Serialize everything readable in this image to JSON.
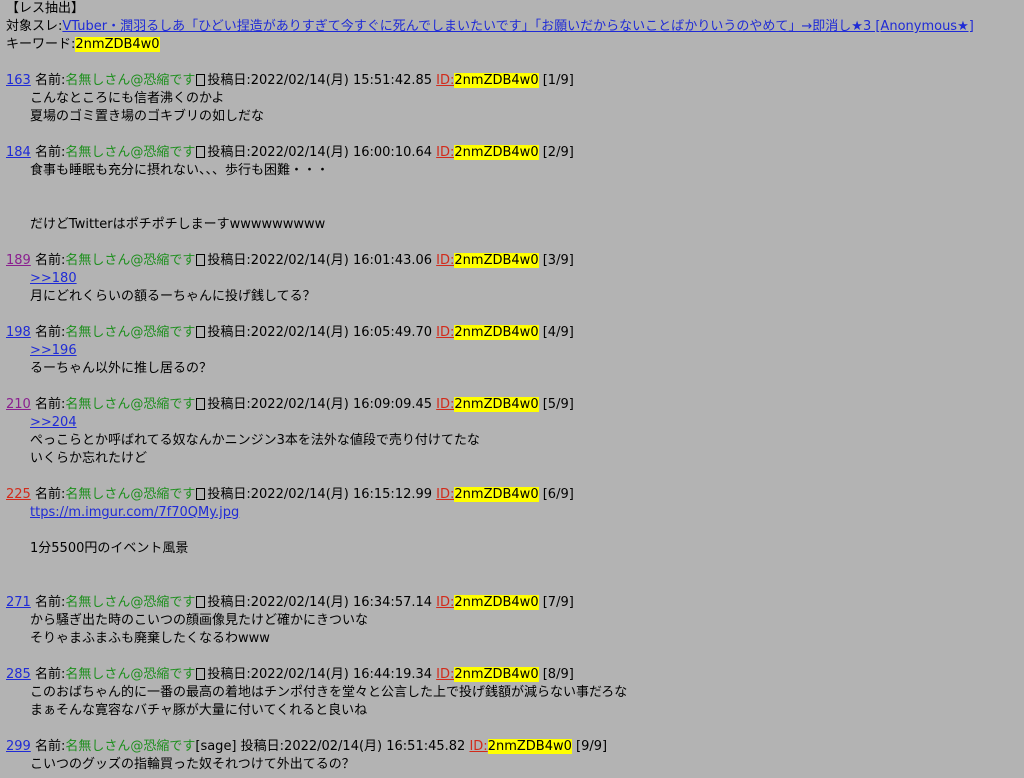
{
  "header": {
    "title": "【レス抽出】",
    "target_label": "対象スレ:",
    "target_thread": "VTuber・潤羽るしあ「ひどい捏造がありすぎて今すぐに死んでしまいたいです」「お願いだからないことばかりいうのやめて」→即消し★3 [Anonymous★]",
    "keyword_label": "キーワード:",
    "keyword": "2nmZDB4w0"
  },
  "posts": [
    {
      "number": "163",
      "name_label": "名前:",
      "name": "名無しさん@恐縮です",
      "box": "□",
      "date_label": "投稿日:",
      "date": "2022/02/14(月) 15:51:42.85",
      "id_label": "ID:",
      "id": "2nmZDB4w0",
      "count": "[1/9]",
      "lines": [
        "こんなところにも信者沸くのかよ",
        "夏場のゴミ置き場のゴキブリの如しだな"
      ]
    },
    {
      "number": "184",
      "name_label": "名前:",
      "name": "名無しさん@恐縮です",
      "box": "□",
      "date_label": "投稿日:",
      "date": "2022/02/14(月) 16:00:10.64",
      "id_label": "ID:",
      "id": "2nmZDB4w0",
      "count": "[2/9]",
      "lines": [
        "食事も睡眠も充分に摂れない、、、歩行も困難・・・",
        "",
        "",
        "だけどTwitterはポチポチしまーすwwwwwwwww"
      ]
    },
    {
      "number": "189",
      "name_label": "名前:",
      "name": "名無しさん@恐縮です",
      "box": "□",
      "date_label": "投稿日:",
      "date": "2022/02/14(月) 16:01:43.06",
      "id_label": "ID:",
      "id": "2nmZDB4w0",
      "count": "[3/9]",
      "anchor": ">>180",
      "lines": [
        "月にどれくらいの額るーちゃんに投げ銭してる？"
      ]
    },
    {
      "number": "198",
      "name_label": "名前:",
      "name": "名無しさん@恐縮です",
      "box": "□",
      "date_label": "投稿日:",
      "date": "2022/02/14(月) 16:05:49.70",
      "id_label": "ID:",
      "id": "2nmZDB4w0",
      "count": "[4/9]",
      "anchor": ">>196",
      "lines": [
        "るーちゃん以外に推し居るの？"
      ]
    },
    {
      "number": "210",
      "name_label": "名前:",
      "name": "名無しさん@恐縮です",
      "box": "□",
      "date_label": "投稿日:",
      "date": "2022/02/14(月) 16:09:09.45",
      "id_label": "ID:",
      "id": "2nmZDB4w0",
      "count": "[5/9]",
      "anchor": ">>204",
      "lines": [
        "ぺっこらとか呼ばれてる奴なんかニンジン3本を法外な値段で売り付けてたな",
        "いくらか忘れたけど"
      ]
    },
    {
      "number": "225",
      "name_label": "名前:",
      "name": "名無しさん@恐縮です",
      "box": "□",
      "date_label": "投稿日:",
      "date": "2022/02/14(月) 16:15:12.99",
      "id_label": "ID:",
      "id": "2nmZDB4w0",
      "count": "[6/9]",
      "url": "ttps://m.imgur.com/7f70QMy.jpg",
      "lines": [
        "",
        "1分5500円のイベント風景"
      ]
    },
    {
      "number": "271",
      "name_label": "名前:",
      "name": "名無しさん@恐縮です",
      "box": "□",
      "date_label": "投稿日:",
      "date": "2022/02/14(月) 16:34:57.14",
      "id_label": "ID:",
      "id": "2nmZDB4w0",
      "count": "[7/9]",
      "lines": [
        "から騒ぎ出た時のこいつの顔画像見たけど確かにきついな",
        "そりゃまふまふも廃棄したくなるわwww"
      ]
    },
    {
      "number": "285",
      "name_label": "名前:",
      "name": "名無しさん@恐縮です",
      "box": "□",
      "date_label": "投稿日:",
      "date": "2022/02/14(月) 16:44:19.34",
      "id_label": "ID:",
      "id": "2nmZDB4w0",
      "count": "[8/9]",
      "lines": [
        "このおばちゃん的に一番の最高の着地はチンポ付きを堂々と公言した上で投げ銭額が減らない事だろな",
        "まぁそんな寛容なバチャ豚が大量に付いてくれると良いね"
      ]
    },
    {
      "number": "299",
      "name_label": "名前:",
      "name": "名無しさん@恐縮です",
      "mail": "[sage]",
      "date_label": "投稿日:",
      "date": "2022/02/14(月) 16:51:45.82",
      "id_label": "ID:",
      "id": "2nmZDB4w0",
      "count": "[9/9]",
      "lines": [
        "こいつのグッズの指輪買った奴それつけて外出てるの？"
      ]
    }
  ]
}
